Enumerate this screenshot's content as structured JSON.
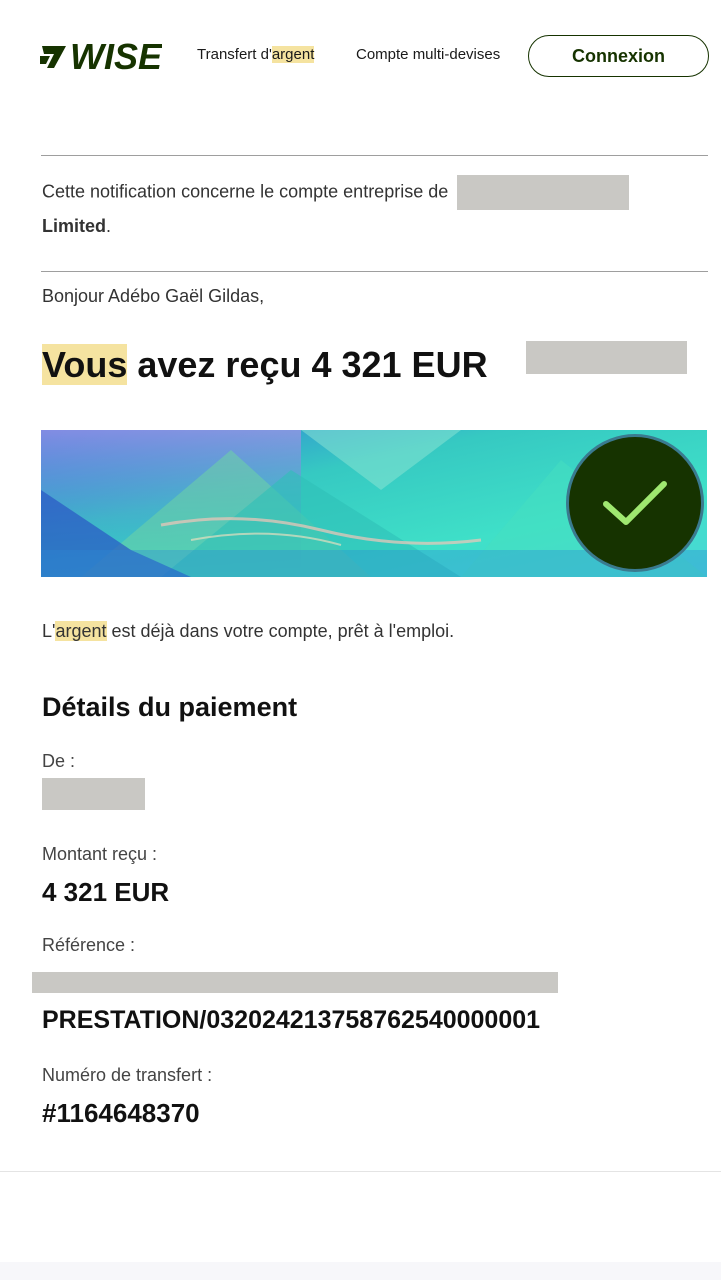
{
  "header": {
    "logo_text": "WISE",
    "nav": {
      "transfer_prefix": "Transfert d'",
      "transfer_highlight": "argent",
      "multi_currency": "Compte multi-devises"
    },
    "login_label": "Connexion"
  },
  "notice": {
    "text": "Cette notification concerne le compte entreprise de",
    "company_suffix": "Limited",
    "period": "."
  },
  "greeting": "Bonjour Adébo Gaël Gildas,",
  "headline": {
    "highlight": "Vous",
    "rest": "avez reçu 4 321 EUR"
  },
  "status_text": {
    "prefix": "L'",
    "highlight": "argent",
    "rest": "est déjà dans votre compte, prêt à l'emploi."
  },
  "payment_details": {
    "title": "Détails du paiement",
    "from_label": "De :",
    "amount_label": "Montant reçu :",
    "amount_value": "4 321 EUR",
    "reference_label": "Référence :",
    "reference_value": "PRESTATION/03202421375876254000000​1",
    "transfer_number_label": "Numéro de transfert :",
    "transfer_number_value": "#1164648370"
  },
  "colors": {
    "brand_dark_green": "#163300",
    "check_green": "#9fe870",
    "highlight": "#f5e3a0",
    "redaction": "#c9c8c4"
  },
  "icons": {
    "logo": "wise-flag-logo",
    "status": "checkmark-icon"
  }
}
